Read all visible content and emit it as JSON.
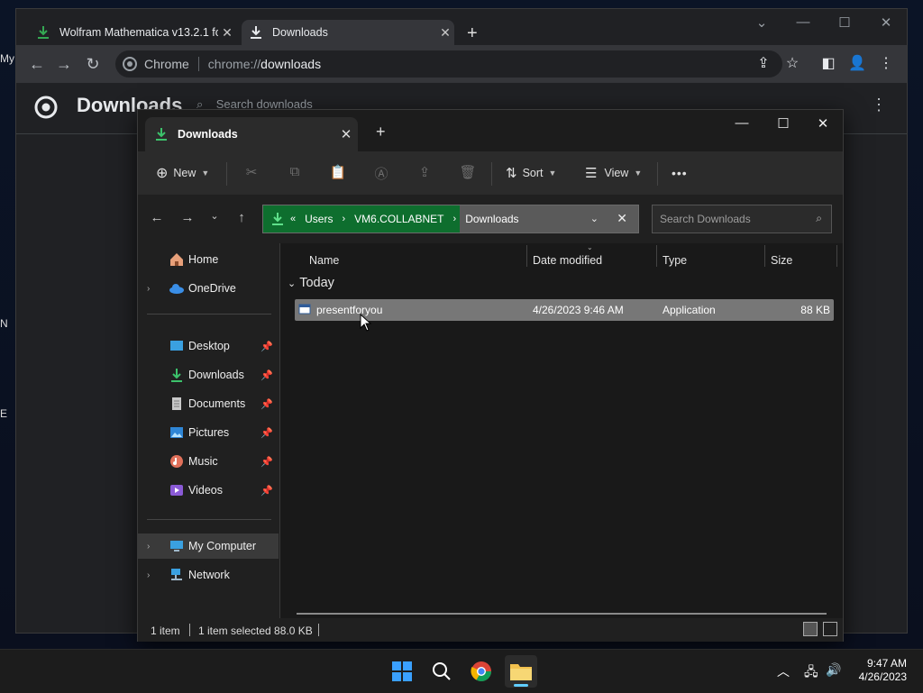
{
  "desktop": {
    "fragments": [
      "My",
      "N",
      "E"
    ]
  },
  "chrome": {
    "tabs": [
      {
        "title": "Wolfram Mathematica v13.2.1 fo"
      },
      {
        "title": "Downloads"
      }
    ],
    "omnibox": {
      "site_label": "Chrome",
      "url_scheme": "chrome://",
      "url_path": "downloads"
    },
    "page": {
      "title": "Downloads",
      "search_placeholder": "Search downloads"
    }
  },
  "explorer": {
    "tab_title": "Downloads",
    "commands": {
      "new": "New",
      "sort": "Sort",
      "view": "View",
      "more": "•••"
    },
    "address": {
      "crumbs": [
        "Users",
        "VM6.COLLABNET",
        "Downloads"
      ]
    },
    "search_placeholder": "Search Downloads",
    "nav": {
      "home": "Home",
      "onedrive": "OneDrive",
      "pinned": [
        "Desktop",
        "Downloads",
        "Documents",
        "Pictures",
        "Music",
        "Videos"
      ],
      "my_computer": "My Computer",
      "network": "Network"
    },
    "columns": {
      "name": "Name",
      "date": "Date modified",
      "type": "Type",
      "size": "Size"
    },
    "group": "Today",
    "files": [
      {
        "name": "presentforyou",
        "date": "4/26/2023 9:46 AM",
        "type": "Application",
        "size": "88 KB"
      }
    ],
    "status": {
      "count": "1 item",
      "selected": "1 item selected  88.0 KB"
    }
  },
  "taskbar": {
    "time": "9:47 AM",
    "date": "4/26/2023"
  },
  "colors": {
    "accent_green": "#0e6e2e",
    "selection": "#777777",
    "chrome_bg": "#202124",
    "explorer_bg": "#202020"
  }
}
